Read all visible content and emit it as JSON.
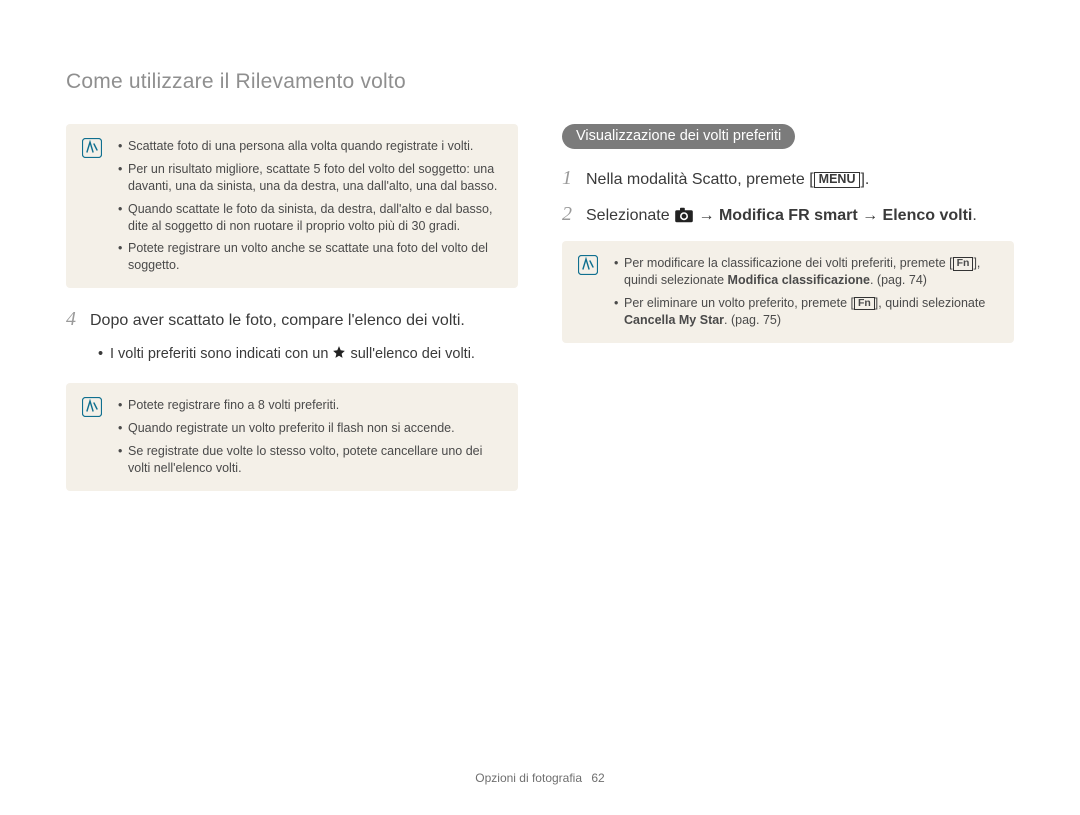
{
  "pageTitle": "Come utilizzare il Rilevamento volto",
  "left": {
    "noteA": {
      "items": [
        "Scattate foto di una persona alla volta quando registrate i volti.",
        "Per un risultato migliore, scattate 5 foto del volto del soggetto: una davanti, una da sinista, una da destra, una dall'alto, una dal basso.",
        "Quando scattate le foto da sinista, da destra, dall'alto e dal basso, dite al soggetto di non ruotare il proprio volto più di 30 gradi.",
        "Potete registrare un volto anche se scattate una foto del volto del soggetto."
      ]
    },
    "step4": {
      "num": "4",
      "text": "Dopo aver scattato le foto, compare l'elenco dei volti."
    },
    "sub": {
      "prefix": "I volti preferiti sono indicati con un ",
      "suffix": " sull'elenco dei volti."
    },
    "noteB": {
      "items": [
        "Potete registrare fino a 8 volti preferiti.",
        "Quando registrate un volto preferito il flash non si accende.",
        "Se registrate due volte lo stesso volto, potete cancellare uno dei volti nell'elenco volti."
      ]
    }
  },
  "right": {
    "heading": "Visualizzazione dei volti preferiti",
    "step1": {
      "num": "1",
      "prefix": "Nella modalità Scatto, premete [",
      "menu": "MENU",
      "suffix": "]."
    },
    "step2": {
      "num": "2",
      "prefix": "Selezionate ",
      "arrow1": " → ",
      "bold1": "Modifica FR smart",
      "arrow2": " → ",
      "bold2": "Elenco volti",
      "suffix": "."
    },
    "note": {
      "item1_a": "Per modificare la classificazione dei volti preferiti, premete [",
      "item1_fn": "Fn",
      "item1_b": "], quindi selezionate ",
      "item1_bold": "Modifica classificazione",
      "item1_c": ". (pag. 74)",
      "item2_a": "Per eliminare un volto preferito, premete [",
      "item2_fn": "Fn",
      "item2_b": "], quindi selezionate ",
      "item2_bold": "Cancella My Star",
      "item2_c": ". (pag. 75)"
    }
  },
  "footer": {
    "section": "Opzioni di fotografia",
    "page": "62"
  }
}
